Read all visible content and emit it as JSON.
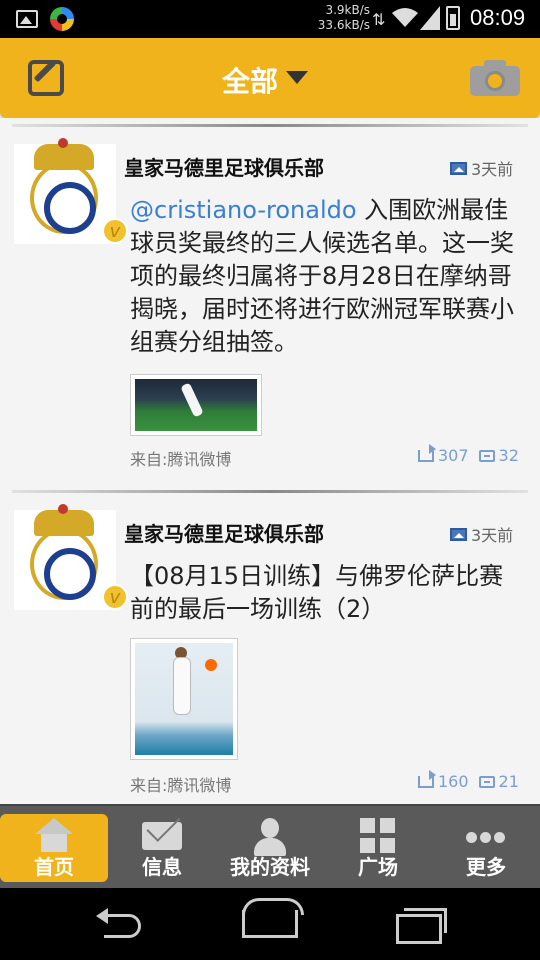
{
  "statusbar": {
    "speed_down": "3.9kB/s",
    "speed_up": "33.6kB/s",
    "time": "08:09"
  },
  "header": {
    "title": "全部",
    "left_icon": "compose-icon",
    "right_icon": "camera-icon",
    "accent_color": "#f0b31c"
  },
  "feed": {
    "posts": [
      {
        "author": "皇家马德里足球俱乐部",
        "time": "3天前",
        "mention": "@cristiano-ronaldo",
        "content": " 入围欧洲最佳球员奖最终的三人候选名单。这一奖项的最终归属将于8月28日在摩纳哥揭晓，届时还将进行欧洲冠军联赛小组赛分组抽签。",
        "source": "来自:腾讯微博",
        "reposts": "307",
        "comments": "32",
        "verified_badge": "v"
      },
      {
        "author": "皇家马德里足球俱乐部",
        "time": "3天前",
        "content": "【08月15日训练】与佛罗伦萨比赛前的最后一场训练（2）",
        "source": "来自:腾讯微博",
        "reposts": "160",
        "comments": "21",
        "verified_badge": "v"
      }
    ]
  },
  "tabbar": {
    "tabs": [
      {
        "label": "首页",
        "icon": "home-icon",
        "active": true
      },
      {
        "label": "信息",
        "icon": "mail-icon",
        "active": false
      },
      {
        "label": "我的资料",
        "icon": "user-icon",
        "active": false
      },
      {
        "label": "广场",
        "icon": "grid-icon",
        "active": false
      },
      {
        "label": "更多",
        "icon": "more-icon",
        "active": false
      }
    ]
  },
  "navbar": {
    "icons": [
      "back-icon",
      "home-icon",
      "recent-apps-icon"
    ]
  }
}
